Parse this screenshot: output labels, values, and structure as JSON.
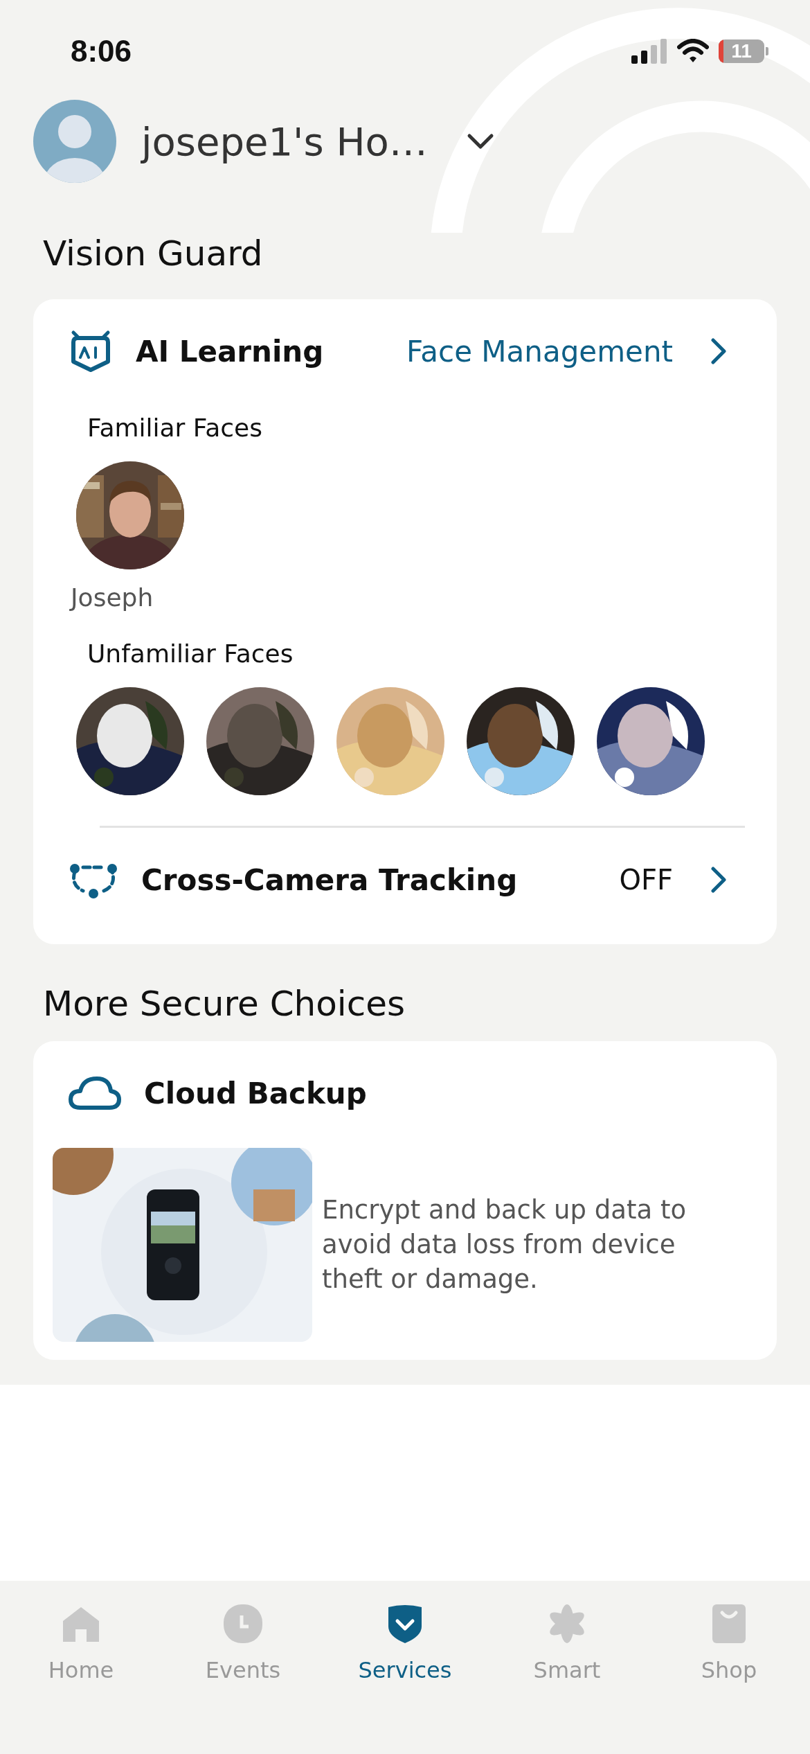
{
  "status_bar": {
    "time": "8:06",
    "battery": "11"
  },
  "header": {
    "home_name": "josepe1's Ho…"
  },
  "vision_guard": {
    "title": "Vision Guard",
    "ai_learning": {
      "title": "AI Learning",
      "link": "Face Management",
      "familiar_label": "Familiar Faces",
      "familiar": [
        {
          "name": "Joseph",
          "kind": "picture"
        }
      ],
      "unfamiliar_label": "Unfamiliar Faces"
    },
    "tracking": {
      "title": "Cross-Camera Tracking",
      "value": "OFF"
    }
  },
  "more": {
    "title": "More Secure Choices",
    "cloud": {
      "title": "Cloud Backup",
      "description": "Encrypt and back up data to avoid data loss from device theft or damage.",
      "kind": "picture"
    }
  },
  "tabs": [
    {
      "label": "Home",
      "kind": "home",
      "selected": false
    },
    {
      "label": "Events",
      "kind": "events",
      "selected": false
    },
    {
      "label": "Services",
      "kind": "services",
      "selected": true
    },
    {
      "label": "Smart",
      "kind": "smart",
      "selected": false
    },
    {
      "label": "Shop",
      "kind": "shop",
      "selected": false
    }
  ]
}
